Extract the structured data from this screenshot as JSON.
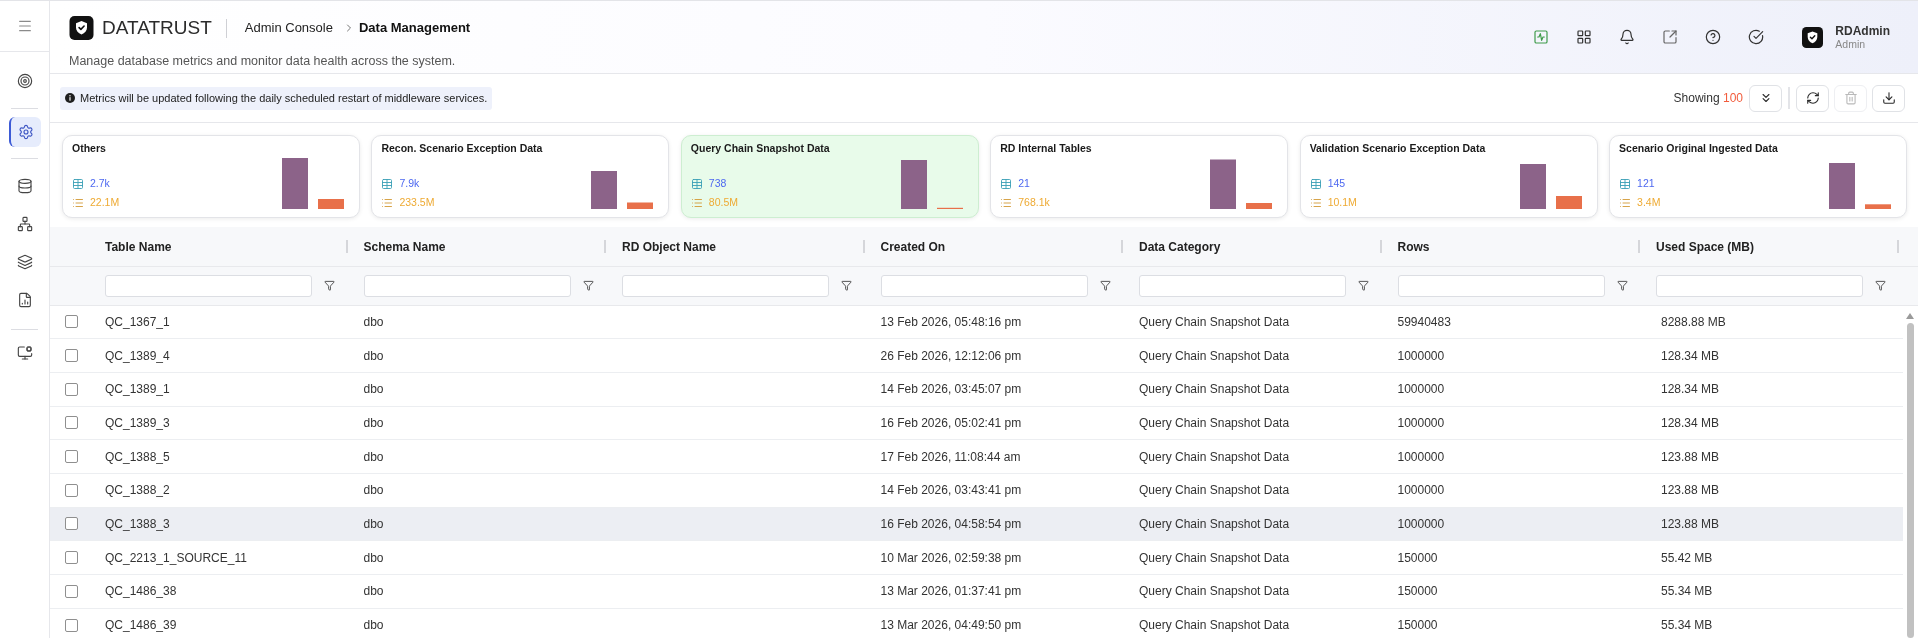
{
  "sidebar": {
    "items": [
      {
        "selected": false
      },
      {
        "selected": true
      },
      {
        "selected": false
      },
      {
        "selected": false
      },
      {
        "selected": false
      },
      {
        "selected": false
      },
      {
        "selected": false
      }
    ]
  },
  "header": {
    "logo": "DATATRUST",
    "breadcrumb": [
      "Admin Console",
      "Data Management"
    ],
    "subtitle": "Manage database metrics and monitor data health across the system.",
    "user": {
      "name": "RDAdmin",
      "role": "Admin"
    }
  },
  "toolbar": {
    "notice": "Metrics will be updated following the daily scheduled restart of middleware services.",
    "showing": {
      "label": "Showing",
      "count": "100"
    },
    "buttons": [
      {
        "disabled": false
      },
      {
        "disabled": false
      },
      {
        "disabled": true
      },
      {
        "disabled": false
      }
    ]
  },
  "cards": [
    {
      "title": "Others",
      "selected": false,
      "metrics": [
        "2.7k",
        "22.1M"
      ]
    },
    {
      "title": "Recon. Scenario Exception Data",
      "selected": false,
      "metrics": [
        "7.9k",
        "233.5M"
      ]
    },
    {
      "title": "Query Chain Snapshot Data",
      "selected": true,
      "metrics": [
        "738",
        "80.5M"
      ]
    },
    {
      "title": "RD Internal Tables",
      "selected": false,
      "metrics": [
        "21",
        "768.1k"
      ]
    },
    {
      "title": "Validation Scenario Exception Data",
      "selected": false,
      "metrics": [
        "145",
        "10.1M"
      ]
    },
    {
      "title": "Scenario Original Ingested Data",
      "selected": false,
      "metrics": [
        "121",
        "3.4M"
      ]
    }
  ],
  "table": {
    "columns": [
      "Table Name",
      "Schema Name",
      "RD Object Name",
      "Created On",
      "Data Category",
      "Rows",
      "Used Space (MB)"
    ],
    "rows": [
      {
        "checked": false,
        "hovered": false,
        "cells": {
          "table_name": "QC_1367_1",
          "schema_name": "dbo",
          "created_on": "13 Feb 2026, 05:48:16 pm",
          "data_category": "Query Chain Snapshot Data",
          "row_count": "59940483",
          "used_space": "8288.88 MB"
        }
      },
      {
        "checked": false,
        "hovered": false,
        "cells": {
          "table_name": "QC_1389_4",
          "schema_name": "dbo",
          "created_on": "26 Feb 2026, 12:12:06 pm",
          "data_category": "Query Chain Snapshot Data",
          "row_count": "1000000",
          "used_space": "128.34 MB"
        }
      },
      {
        "checked": false,
        "hovered": false,
        "cells": {
          "table_name": "QC_1389_1",
          "schema_name": "dbo",
          "created_on": "14 Feb 2026, 03:45:07 pm",
          "data_category": "Query Chain Snapshot Data",
          "row_count": "1000000",
          "used_space": "128.34 MB"
        }
      },
      {
        "checked": false,
        "hovered": false,
        "cells": {
          "table_name": "QC_1389_3",
          "schema_name": "dbo",
          "created_on": "16 Feb 2026, 05:02:41 pm",
          "data_category": "Query Chain Snapshot Data",
          "row_count": "1000000",
          "used_space": "128.34 MB"
        }
      },
      {
        "checked": false,
        "hovered": false,
        "cells": {
          "table_name": "QC_1388_5",
          "schema_name": "dbo",
          "created_on": "17 Feb 2026, 11:08:44 am",
          "data_category": "Query Chain Snapshot Data",
          "row_count": "1000000",
          "used_space": "123.88 MB"
        }
      },
      {
        "checked": false,
        "hovered": false,
        "cells": {
          "table_name": "QC_1388_2",
          "schema_name": "dbo",
          "created_on": "14 Feb 2026, 03:43:41 pm",
          "data_category": "Query Chain Snapshot Data",
          "row_count": "1000000",
          "used_space": "123.88 MB"
        }
      },
      {
        "checked": false,
        "hovered": true,
        "cells": {
          "table_name": "QC_1388_3",
          "schema_name": "dbo",
          "created_on": "16 Feb 2026, 04:58:54 pm",
          "data_category": "Query Chain Snapshot Data",
          "row_count": "1000000",
          "used_space": "123.88 MB"
        }
      },
      {
        "checked": false,
        "hovered": false,
        "cells": {
          "table_name": "QC_2213_1_SOURCE_11",
          "schema_name": "dbo",
          "created_on": "10 Mar 2026, 02:59:38 pm",
          "data_category": "Query Chain Snapshot Data",
          "row_count": "150000",
          "used_space": "55.42 MB"
        }
      },
      {
        "checked": false,
        "hovered": false,
        "cells": {
          "table_name": "QC_1486_38",
          "schema_name": "dbo",
          "created_on": "13 Mar 2026, 01:37:41 pm",
          "data_category": "Query Chain Snapshot Data",
          "row_count": "150000",
          "used_space": "55.34 MB"
        }
      },
      {
        "checked": false,
        "hovered": false,
        "cells": {
          "table_name": "QC_1486_39",
          "schema_name": "dbo",
          "created_on": "13 Mar 2026, 04:49:50 pm",
          "data_category": "Query Chain Snapshot Data",
          "row_count": "150000",
          "used_space": "55.34 MB"
        }
      }
    ]
  }
}
